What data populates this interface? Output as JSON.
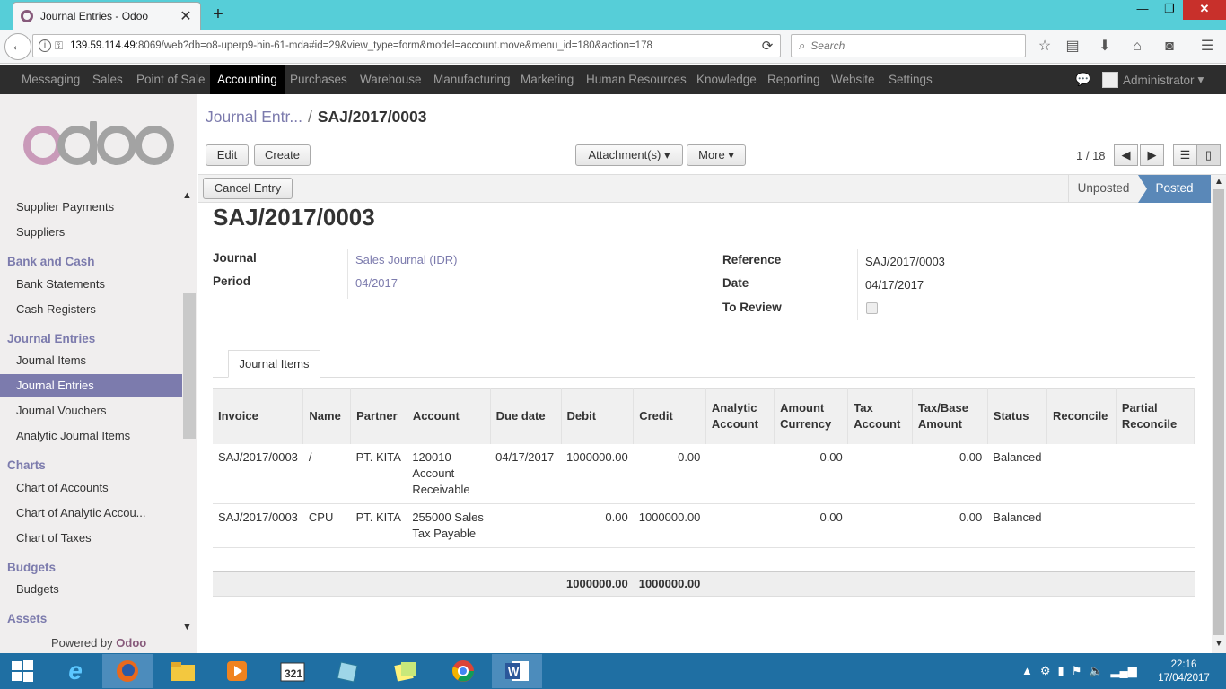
{
  "browser": {
    "tab_title": "Journal Entries - Odoo",
    "url_host": "139.59.114.49",
    "url_rest": ":8069/web?db=o8-uperp9-hin-61-mda#id=29&view_type=form&model=account.move&menu_id=180&action=178",
    "search_placeholder": "Search"
  },
  "topmenu": {
    "items": [
      "Messaging",
      "Sales",
      "Point of Sale",
      "Accounting",
      "Purchases",
      "Warehouse",
      "Manufacturing",
      "Marketing",
      "Human Resources",
      "Knowledge",
      "Reporting",
      "Website",
      "Settings"
    ],
    "active": "Accounting",
    "user": "Administrator"
  },
  "sidebar": {
    "items": [
      {
        "type": "item",
        "label": "Supplier Payments"
      },
      {
        "type": "item",
        "label": "Suppliers"
      },
      {
        "type": "group",
        "label": "Bank and Cash"
      },
      {
        "type": "item",
        "label": "Bank Statements"
      },
      {
        "type": "item",
        "label": "Cash Registers"
      },
      {
        "type": "group",
        "label": "Journal Entries"
      },
      {
        "type": "item",
        "label": "Journal Items"
      },
      {
        "type": "item",
        "label": "Journal Entries",
        "selected": true
      },
      {
        "type": "item",
        "label": "Journal Vouchers"
      },
      {
        "type": "item",
        "label": "Analytic Journal Items"
      },
      {
        "type": "group",
        "label": "Charts"
      },
      {
        "type": "item",
        "label": "Chart of Accounts"
      },
      {
        "type": "item",
        "label": "Chart of Analytic Accou..."
      },
      {
        "type": "item",
        "label": "Chart of Taxes"
      },
      {
        "type": "group",
        "label": "Budgets"
      },
      {
        "type": "item",
        "label": "Budgets"
      },
      {
        "type": "group",
        "label": "Assets"
      }
    ],
    "powered_prefix": "Powered by ",
    "powered_brand": "Odoo"
  },
  "breadcrumb": {
    "parent": "Journal Entr...",
    "current": "SAJ/2017/0003"
  },
  "buttons": {
    "edit": "Edit",
    "create": "Create",
    "attachments": "Attachment(s) ▾",
    "more": "More ▾",
    "cancel_entry": "Cancel Entry"
  },
  "pager": {
    "text": "1 / 18"
  },
  "status": {
    "unposted": "Unposted",
    "posted": "Posted"
  },
  "form": {
    "title": "SAJ/2017/0003",
    "journal_label": "Journal",
    "journal_value": "Sales Journal (IDR)",
    "period_label": "Period",
    "period_value": "04/2017",
    "reference_label": "Reference",
    "reference_value": "SAJ/2017/0003",
    "date_label": "Date",
    "date_value": "04/17/2017",
    "to_review_label": "To Review"
  },
  "tab": {
    "journal_items": "Journal Items"
  },
  "table": {
    "headers": [
      "Invoice",
      "Name",
      "Partner",
      "Account",
      "Due date",
      "Debit",
      "Credit",
      "Analytic Account",
      "Amount Currency",
      "Tax Account",
      "Tax/Base Amount",
      "Status",
      "Reconcile",
      "Partial Reconcile"
    ],
    "rows": [
      [
        "SAJ/2017/0003",
        "/",
        "PT. KITA",
        "120010 Account Receivable",
        "04/17/2017",
        "1000000.00",
        "0.00",
        "",
        "0.00",
        "",
        "0.00",
        "Balanced",
        "",
        ""
      ],
      [
        "SAJ/2017/0003",
        "CPU",
        "PT. KITA",
        "255000 Sales Tax Payable",
        "",
        "0.00",
        "1000000.00",
        "",
        "0.00",
        "",
        "0.00",
        "Balanced",
        "",
        ""
      ]
    ],
    "total_debit": "1000000.00",
    "total_credit": "1000000.00"
  },
  "taskbar": {
    "time": "22:16",
    "date": "17/04/2017"
  }
}
